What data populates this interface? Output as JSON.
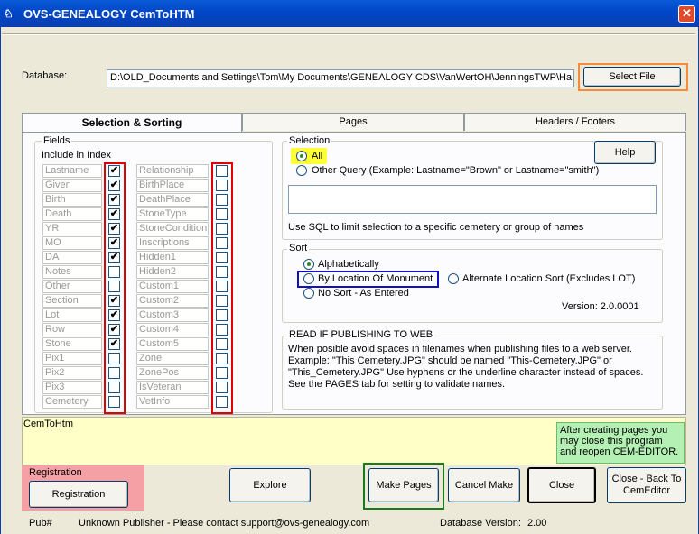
{
  "window": {
    "title": "OVS-GENEALOGY  CemToHTM",
    "close_glyph": "✕"
  },
  "database": {
    "label": "Database:",
    "path": "D:\\OLD_Documents and Settings\\Tom\\My Documents\\GENEALOGY CDS\\VanWertOH\\JenningsTWP\\Ha",
    "select_button": "Select File"
  },
  "tabs": [
    {
      "label": "Selection & Sorting",
      "active": true
    },
    {
      "label": "Pages",
      "active": false
    },
    {
      "label": "Headers / Footers",
      "active": false
    }
  ],
  "fields": {
    "group_label": "Fields",
    "include_label": "Include in Index",
    "left": [
      {
        "name": "Lastname",
        "checked": true
      },
      {
        "name": "Given",
        "checked": true
      },
      {
        "name": "Birth",
        "checked": true
      },
      {
        "name": "Death",
        "checked": true
      },
      {
        "name": "YR",
        "checked": true
      },
      {
        "name": "MO",
        "checked": true
      },
      {
        "name": "DA",
        "checked": true
      },
      {
        "name": "Notes",
        "checked": false
      },
      {
        "name": "Other",
        "checked": false
      },
      {
        "name": "Section",
        "checked": true
      },
      {
        "name": "Lot",
        "checked": true
      },
      {
        "name": "Row",
        "checked": true
      },
      {
        "name": "Stone",
        "checked": true
      },
      {
        "name": "Pix1",
        "checked": false
      },
      {
        "name": "Pix2",
        "checked": false
      },
      {
        "name": "Pix3",
        "checked": false
      },
      {
        "name": "Cemetery",
        "checked": false
      }
    ],
    "right": [
      {
        "name": "Relationship",
        "checked": false
      },
      {
        "name": "BirthPlace",
        "checked": false
      },
      {
        "name": "DeathPlace",
        "checked": false
      },
      {
        "name": "StoneType",
        "checked": false
      },
      {
        "name": "StoneCondition",
        "checked": false
      },
      {
        "name": "Inscriptions",
        "checked": false
      },
      {
        "name": "Hidden1",
        "checked": false
      },
      {
        "name": "Hidden2",
        "checked": false
      },
      {
        "name": "Custom1",
        "checked": false
      },
      {
        "name": "Custom2",
        "checked": false
      },
      {
        "name": "Custom3",
        "checked": false
      },
      {
        "name": "Custom4",
        "checked": false
      },
      {
        "name": "Custom5",
        "checked": false
      },
      {
        "name": "Zone",
        "checked": false
      },
      {
        "name": "ZonePos",
        "checked": false
      },
      {
        "name": "IsVeteran",
        "checked": false
      },
      {
        "name": "VetInfo",
        "checked": false
      }
    ]
  },
  "selection": {
    "group_label": "Selection",
    "all_label": "All",
    "other_label": "Other Query (Example: Lastname=\"Brown\" or Lastname=\"smith\")",
    "help_button": "Help",
    "query_value": "",
    "hint": "Use SQL to limit selection to a specific cemetery or group of names"
  },
  "sort": {
    "group_label": "Sort",
    "alphabetical": "Alphabetically",
    "by_location": "By Location Of Monument",
    "alternate": "Alternate Location Sort (Excludes LOT)",
    "no_sort": "No Sort - As Entered",
    "version": "Version: 2.0.0001"
  },
  "web": {
    "group_label": "READ IF PUBLISHING TO WEB",
    "lines": [
      "When posible avoid spaces in filenames when publishing files to a web server.",
      "Example:  \"This Cemetery.JPG\" should be named  \"This-Cemetery.JPG\" or",
      "\"This_Cemetery.JPG\"    Use hyphens or the underline character instead of spaces.",
      "See the PAGES tab for setting to validate names."
    ]
  },
  "status": {
    "text": "CemToHtm",
    "note": "After creating pages you may close this program and reopen CEM-EDITOR."
  },
  "bottom": {
    "registration_group": "Registration",
    "registration_button": "Registration",
    "explore": "Explore",
    "make_pages": "Make Pages",
    "cancel_make": "Cancel Make",
    "close": "Close",
    "close_back": "Close - Back To CemEditor",
    "pub_label": "Pub#",
    "publisher": "Unknown Publisher - Please  contact  support@ovs-genealogy.com",
    "db_version_label": "Database Version:",
    "db_version": "2.00"
  },
  "colors": {
    "titlebar": "#0046c8",
    "status_bg": "#ffffc8",
    "note_bg": "#b4f0b4",
    "highlight_red": "#e00000",
    "highlight_yellow": "#ffff33",
    "highlight_blue": "#1010c0",
    "highlight_green": "#1a7a1a",
    "highlight_orange": "#f5893c",
    "highlight_pink": "#f5a0a4"
  }
}
